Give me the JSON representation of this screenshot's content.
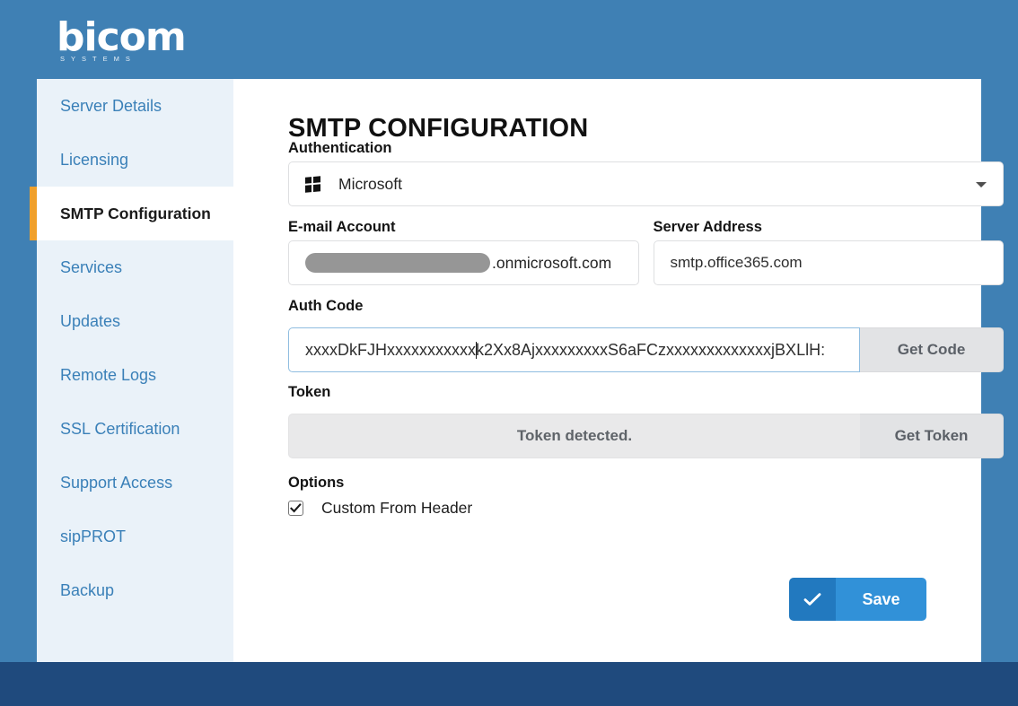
{
  "brand": {
    "name": "bicom",
    "tagline": "SYSTEMS"
  },
  "colors": {
    "header_blue": "#3f80b4",
    "footer_navy": "#1f4a7d",
    "sidebar_bg": "#eaf2f9",
    "sidebar_link": "#3a80b8",
    "active_accent": "#f0a02b",
    "save_button_dark": "#2279bf",
    "save_button_light": "#3191d8",
    "addon_gray": "#e2e3e5",
    "token_gray": "#e9e9ea",
    "redaction_gray": "#969696"
  },
  "sidebar": {
    "items": [
      {
        "label": "Server Details",
        "active": false
      },
      {
        "label": "Licensing",
        "active": false
      },
      {
        "label": "SMTP Configuration",
        "active": true
      },
      {
        "label": "Services",
        "active": false
      },
      {
        "label": "Updates",
        "active": false
      },
      {
        "label": "Remote Logs",
        "active": false
      },
      {
        "label": "SSL Certification",
        "active": false
      },
      {
        "label": "Support Access",
        "active": false
      },
      {
        "label": "sipPROT",
        "active": false
      },
      {
        "label": "Backup",
        "active": false
      }
    ]
  },
  "main": {
    "page_title": "SMTP CONFIGURATION",
    "authentication": {
      "label": "Authentication",
      "selected_value": "Microsoft",
      "icon": "windows-logo-icon",
      "caret_icon": "chevron-down-icon"
    },
    "email_account": {
      "label": "E-mail Account",
      "redacted_value": "",
      "suffix": ".onmicrosoft.com"
    },
    "server_address": {
      "label": "Server Address",
      "value": "smtp.office365.com"
    },
    "auth_code": {
      "label": "Auth Code",
      "value_before_caret": "xxxxDkFJHxxxxxxxxxxx",
      "value_after_caret": "k2Xx8AjxxxxxxxxxS6aFCzxxxxxxxxxxxxxjBXLlH:",
      "button_label": "Get Code"
    },
    "token": {
      "label": "Token",
      "status_text": "Token detected.",
      "button_label": "Get Token"
    },
    "options": {
      "label": "Options",
      "items": [
        {
          "label": "Custom From Header",
          "checked": true
        }
      ]
    },
    "save": {
      "label": "Save",
      "icon": "check-icon"
    }
  }
}
